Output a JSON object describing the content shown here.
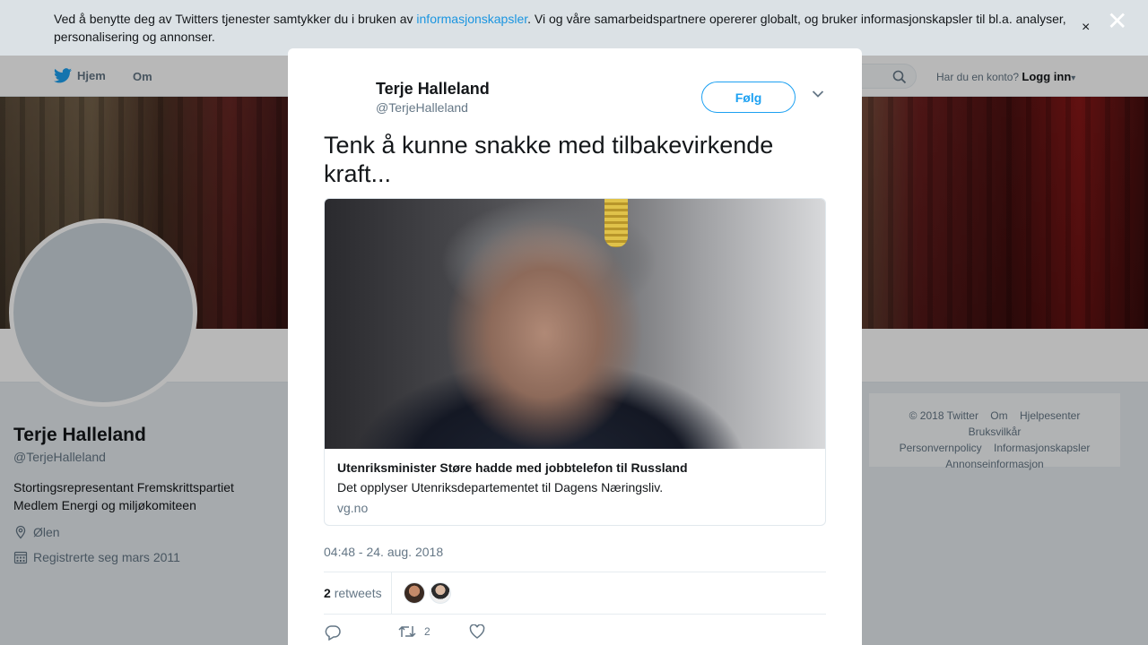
{
  "cookie": {
    "text_before": "Ved å benytte deg av Twitters tjenester samtykker du i bruken av ",
    "link": "informasjonskapsler",
    "text_after": ". Vi og våre samarbeidspartnere opererer globalt, og bruker informasjonskapsler til bl.a. analyser, personalisering og annonser.",
    "close": "×"
  },
  "overlay_close": "✕",
  "nav": {
    "home": "Hjem",
    "about": "Om",
    "account_prompt": "Har du en konto?",
    "login": "Logg inn"
  },
  "profile": {
    "name": "Terje Halleland",
    "handle": "@TerjeHalleland",
    "bio": "Stortingsrepresentant Fremskrittspartiet\nMedlem Energi og miljøkomiteen",
    "location": "Ølen",
    "joined": "Registrerte seg mars 2011"
  },
  "footer": {
    "links": [
      "© 2018 Twitter",
      "Om",
      "Hjelpesenter",
      "Bruksvilkår",
      "Personvernpolicy",
      "Informasjonskapsler",
      "Annonseinformasjon"
    ]
  },
  "tweet": {
    "author_name": "Terje Halleland",
    "author_handle": "@TerjeHalleland",
    "follow_label": "Følg",
    "text": "Tenk å kunne snakke med tilbakevirkende kraft...",
    "card": {
      "title": "Utenriksminister Støre hadde med jobbtelefon til Russland",
      "description": "Det opplyser Utenriksdepartementet til Dagens Næringsliv.",
      "domain": "vg.no"
    },
    "timestamp": "04:48 - 24. aug. 2018",
    "retweet_count": "2",
    "retweet_label": "retweets",
    "actions": {
      "reply_count": "",
      "retweet_count": "2",
      "like_count": ""
    }
  },
  "colors": {
    "accent": "#1da1f2",
    "link": "#1b95e0",
    "muted": "#657786"
  }
}
